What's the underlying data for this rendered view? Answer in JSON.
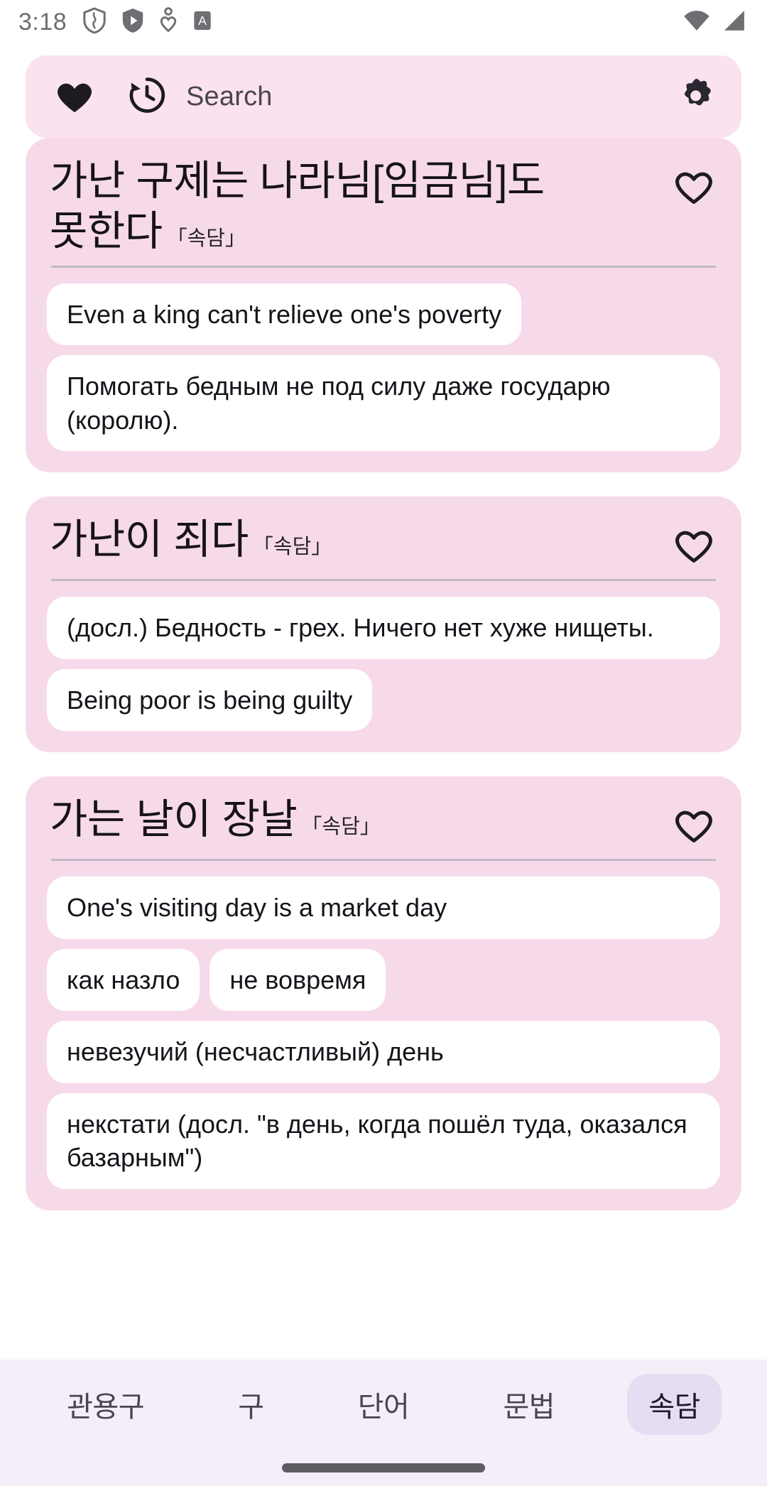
{
  "status_bar": {
    "time": "3:18",
    "left_icons": [
      "shield-icon",
      "play-badge-icon",
      "heart-outline-small-icon",
      "letter-a-badge-icon"
    ],
    "right_icons": [
      "wifi-icon",
      "cellular-signal-icon"
    ]
  },
  "search": {
    "favorite_icon": "heart-filled-icon",
    "history_icon": "history-clock-icon",
    "placeholder": "Search",
    "settings_icon": "gear-icon"
  },
  "colors": {
    "page_background": "#FFFFFF",
    "search_bar": "#FAE2EE",
    "card_background": "#F7DAE9",
    "chip_background": "#FFFFFF",
    "divider": "#BDB9C4",
    "nav_background": "#F3EEF8",
    "nav_selected_pill": "#E6DDF3",
    "text_primary": "#16131A",
    "text_secondary": "#49454F"
  },
  "cards": [
    {
      "title": "가난 구제는 나라님[임금님]도 못한다",
      "pos_tag": "「속담」",
      "favorite_icon": "heart-outline-icon",
      "favorited": false,
      "entries": [
        {
          "text": "Even a king can't relieve one's poverty",
          "full_width": false
        },
        {
          "text": "Помогать бедным не под силу даже государю (королю).",
          "full_width": true
        }
      ]
    },
    {
      "title": "가난이 죄다",
      "pos_tag": "「속담」",
      "favorite_icon": "heart-outline-icon",
      "favorited": false,
      "entries": [
        {
          "text": "(досл.) Бедность - грех. Ничего нет хуже нищеты.",
          "full_width": true
        },
        {
          "text": "Being poor is being guilty",
          "full_width": false
        }
      ]
    },
    {
      "title": "가는 날이 장날",
      "pos_tag": "「속담」",
      "favorite_icon": "heart-outline-icon",
      "favorited": false,
      "entries": [
        {
          "text": "One's visiting day is a market day",
          "full_width": false
        },
        {
          "text": "как назло",
          "full_width": false
        },
        {
          "text": "не вовремя",
          "full_width": false
        },
        {
          "text": "невезучий (несчастливый) день",
          "full_width": false
        },
        {
          "text": "некстати (досл. \"в день, когда пошёл туда, оказался базарным\")",
          "full_width": true
        }
      ]
    }
  ],
  "bottom_nav": {
    "tabs": [
      {
        "label": "관용구",
        "selected": false
      },
      {
        "label": "구",
        "selected": false
      },
      {
        "label": "단어",
        "selected": false
      },
      {
        "label": "문법",
        "selected": false
      },
      {
        "label": "속담",
        "selected": true
      }
    ],
    "home_indicator": "home-indicator"
  }
}
